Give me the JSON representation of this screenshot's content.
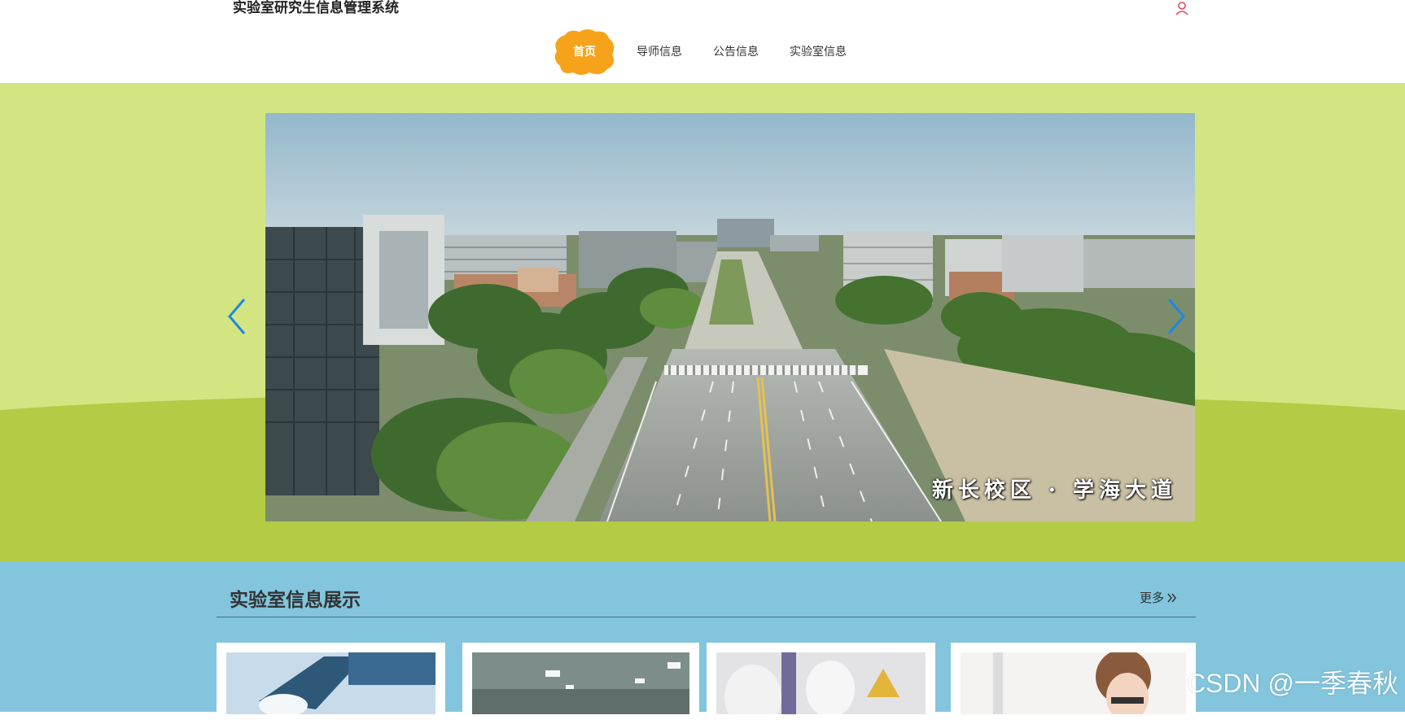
{
  "header": {
    "site_title": "实验室研究生信息管理系统",
    "user_icon": "user-icon",
    "nav": [
      {
        "label": "首页",
        "active": true
      },
      {
        "label": "导师信息",
        "active": false
      },
      {
        "label": "公告信息",
        "active": false
      },
      {
        "label": "实验室信息",
        "active": false
      }
    ]
  },
  "banner": {
    "caption": "新长校区 · 学海大道",
    "prev_icon": "chevron-left-icon",
    "next_icon": "chevron-right-icon"
  },
  "lab_section": {
    "title": "实验室信息展示",
    "more_label": "更多"
  },
  "watermark": "CSDN @一季春秋",
  "colors": {
    "accent": "#f7a21b",
    "banner_top": "#d3e582",
    "banner_bottom": "#b3cb45",
    "section_bg": "#82c5dd",
    "arrow": "#1a8ae0",
    "user_icon": "#e0455c"
  }
}
